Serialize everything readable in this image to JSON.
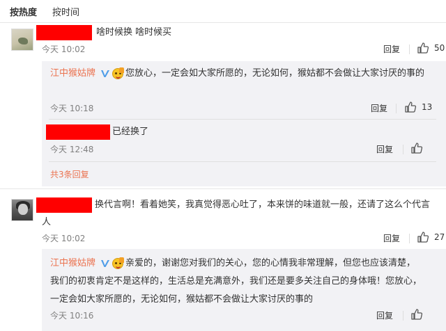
{
  "sort": {
    "hot_label": "按热度",
    "time_label": "按时间"
  },
  "comments": [
    {
      "text": "啥时候换 啥时候买",
      "time": "今天 10:02",
      "reply_label": "回复",
      "likes": "50",
      "replies": [
        {
          "name": "江中猴姑牌",
          "text": "您放心，一定会如大家所愿的，无论如何，猴姑都不会做让大家讨厌的事的",
          "time": "今天 10:18",
          "reply_label": "回复",
          "likes": "13"
        },
        {
          "text": "已经换了",
          "time": "今天 12:48",
          "reply_label": "回复",
          "likes": ""
        }
      ],
      "more_replies": "共3条回复"
    },
    {
      "text_line1": "换代言啊！看着她笑，我真觉得恶心吐了，本来饼的味道就一般，还请了这么个代言",
      "text_line2": "人",
      "time": "今天 10:02",
      "reply_label": "回复",
      "likes": "27",
      "replies": [
        {
          "name": "江中猴姑牌",
          "line1": "亲爱的，谢谢您对我们的关心，您的心情我非常理解，但您也应该清楚，",
          "line2": "我们的初衷肯定不是这样的，生活总是充满意外，我们还是要多关注自己的身体哦！您放心，",
          "line3": "一定会如大家所愿的，无论如何，猴姑都不会做让大家讨厌的事的",
          "time": "今天 10:16",
          "reply_label": "回复",
          "likes": ""
        }
      ]
    }
  ],
  "colors": {
    "name": "#eb7350",
    "redaction": "#ff0000",
    "reply_bg": "#f2f2f5",
    "verified": "#4f9de8"
  },
  "icons": [
    "thumbs-up-icon",
    "verified-icon",
    "emoji-icon"
  ]
}
